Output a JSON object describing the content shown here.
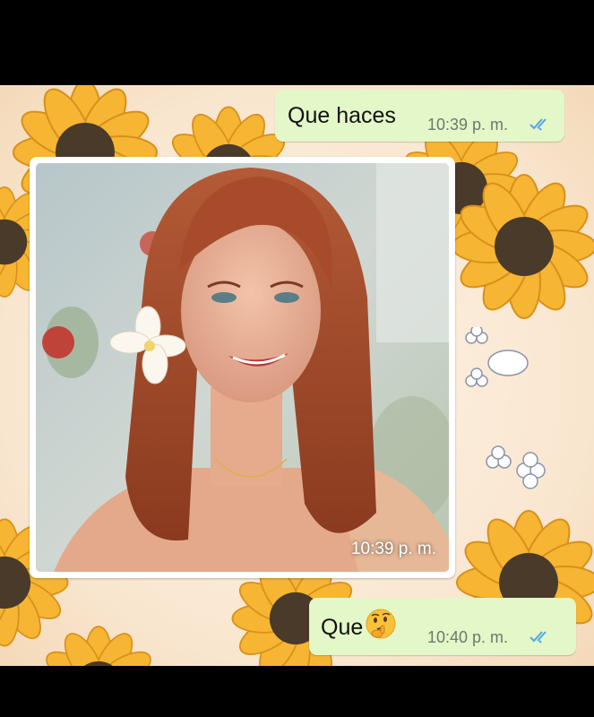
{
  "messages": [
    {
      "type": "text-out",
      "text": "Que haces",
      "time": "10:39 p. m.",
      "status": "read"
    },
    {
      "type": "image-in",
      "time": "10:39 p. m.",
      "image_description": "woman with long red hair and white flower smiling"
    },
    {
      "type": "text-out",
      "text": "Que",
      "emoji": "🤔",
      "emoji_name": "thinking-face",
      "time": "10:40 p. m.",
      "status": "read"
    }
  ],
  "wallpaper": {
    "theme": "sunflowers",
    "petal_color": "#f6b533",
    "center_color": "#4a3a2a"
  },
  "colors": {
    "bubble_out": "#e3f7c8",
    "read_ticks": "#53a6e8"
  }
}
